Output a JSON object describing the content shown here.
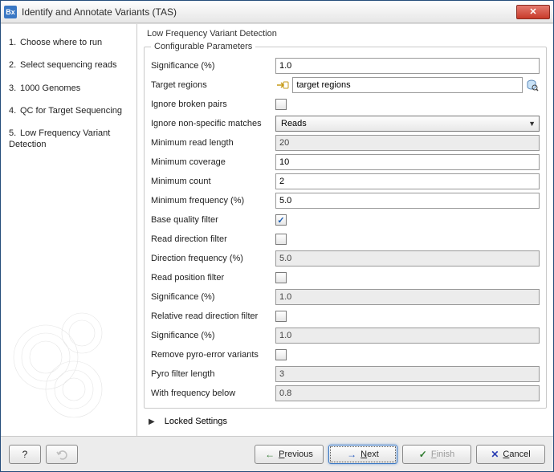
{
  "window": {
    "title": "Identify and Annotate Variants (TAS)"
  },
  "sidebar": {
    "steps": [
      "Choose where to run",
      "Select sequencing reads",
      "1000 Genomes",
      "QC for Target Sequencing",
      "Low Frequency Variant Detection"
    ]
  },
  "main": {
    "section_title": "Low Frequency Variant Detection",
    "group_legend": "Configurable Parameters",
    "locked_settings": "Locked Settings"
  },
  "fields": {
    "significance": {
      "label": "Significance (%)",
      "value": "1.0"
    },
    "target_regions": {
      "label": "Target regions",
      "value": "target regions"
    },
    "ignore_broken_pairs": {
      "label": "Ignore broken pairs",
      "checked": false
    },
    "ignore_nonspecific": {
      "label": "Ignore non-specific matches",
      "value": "Reads"
    },
    "min_read_length": {
      "label": "Minimum read length",
      "value": "20"
    },
    "min_coverage": {
      "label": "Minimum coverage",
      "value": "10"
    },
    "min_count": {
      "label": "Minimum count",
      "value": "2"
    },
    "min_frequency": {
      "label": "Minimum frequency (%)",
      "value": "5.0"
    },
    "base_quality_filter": {
      "label": "Base quality filter",
      "checked": true
    },
    "read_direction_filter": {
      "label": "Read direction filter",
      "checked": false
    },
    "direction_frequency": {
      "label": "Direction frequency (%)",
      "value": "5.0"
    },
    "read_position_filter": {
      "label": "Read position filter",
      "checked": false
    },
    "significance2": {
      "label": "Significance (%)",
      "value": "1.0"
    },
    "relative_read_direction_filter": {
      "label": "Relative read direction filter",
      "checked": false
    },
    "significance3": {
      "label": "Significance (%)",
      "value": "1.0"
    },
    "remove_pyro_error": {
      "label": "Remove pyro-error variants",
      "checked": false
    },
    "pyro_filter_length": {
      "label": "Pyro filter length",
      "value": "3"
    },
    "with_frequency_below": {
      "label": "With frequency below",
      "value": "0.8"
    }
  },
  "footer": {
    "previous": "Previous",
    "next": "Next",
    "finish": "Finish",
    "cancel": "Cancel"
  }
}
